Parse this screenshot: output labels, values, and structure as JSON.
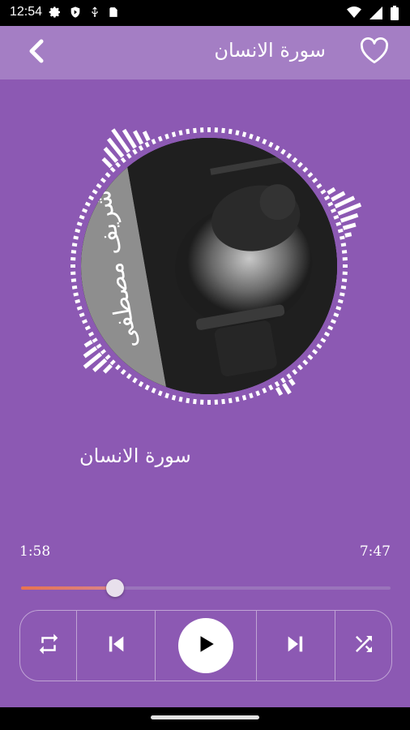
{
  "status_bar": {
    "time": "12:54",
    "left_icons": [
      "gear-icon",
      "shield-icon",
      "usb-icon",
      "sd-card-icon"
    ],
    "right_icons": [
      "wifi-icon",
      "signal-icon",
      "battery-icon"
    ]
  },
  "header": {
    "title": "سورة الانسان",
    "back_icon": "chevron-left-icon",
    "favorite_icon": "heart-outline-icon"
  },
  "cover": {
    "calligraphy_text": "شريف مصطفى"
  },
  "track": {
    "title": "سورة الانسان",
    "current_time": "1:58",
    "total_time": "7:47",
    "progress": 0.254
  },
  "controls": {
    "icons": [
      "repeat-icon",
      "skip-previous-icon",
      "play-icon",
      "skip-next-icon",
      "shuffle-icon"
    ]
  },
  "colors": {
    "background": "#8c59b3",
    "app_bar": "#a47ec4",
    "accent": "#e8744f"
  }
}
